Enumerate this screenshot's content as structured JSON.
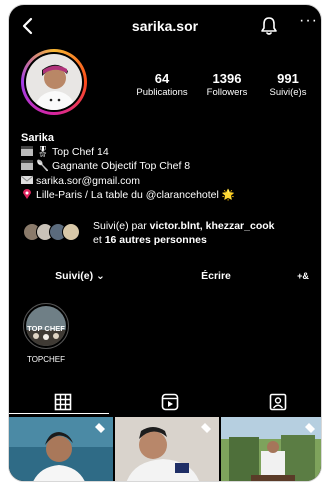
{
  "profile": {
    "username": "sarika.sor",
    "display_name": "Sarika",
    "stats": [
      {
        "value": "64",
        "label": "Publications"
      },
      {
        "value": "1396",
        "label": "Followers"
      },
      {
        "value": "991",
        "label": "Suivi(e)s"
      }
    ],
    "bio_lines": [
      {
        "icon": "clapper-icon",
        "text": "🎖 Top Chef 14"
      },
      {
        "icon": "clapper-icon",
        "text": "🥄 Gagnante Objectif Top Chef 8"
      },
      {
        "icon": "envelope-icon",
        "text": "sarika.sor@gmail.com"
      },
      {
        "icon": "pin-icon",
        "text": "Lille-Paris / La table du @clarancehotel 🌟"
      }
    ],
    "followed_by": {
      "prefix": "Suivi(e) par ",
      "names": "victor.blnt, khezzar_cook",
      "line2_prefix": "et ",
      "others": "16 autres personnes"
    }
  },
  "buttons": {
    "follow": "Suivi(e) ⌄",
    "message": "Écrire",
    "add_user": "+&"
  },
  "highlights": [
    {
      "label": "TOPCHEF"
    }
  ],
  "tabs": [
    "grid-icon",
    "reels-icon",
    "tagged-icon"
  ],
  "colors": {
    "background": "#000000",
    "text": "#ffffff",
    "button_bg": "#262626",
    "ring": [
      "#f7b733",
      "#fc4a1a",
      "#d6249f",
      "#a23ee8"
    ]
  }
}
